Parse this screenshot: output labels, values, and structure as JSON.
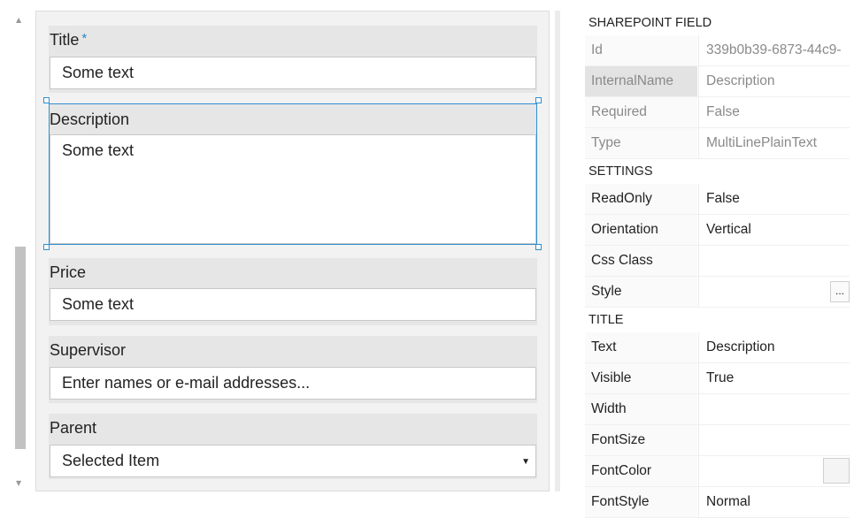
{
  "form": {
    "fields": [
      {
        "label": "Title",
        "required_marker": "*",
        "value": "Some text"
      },
      {
        "label": "Description",
        "value": "Some text"
      },
      {
        "label": "Price",
        "value": "Some text"
      },
      {
        "label": "Supervisor",
        "placeholder": "Enter names or e-mail addresses..."
      },
      {
        "label": "Parent",
        "value": "Selected Item"
      }
    ]
  },
  "properties": {
    "sections": [
      {
        "title": "SHAREPOINT FIELD",
        "rows": [
          {
            "key": "Id",
            "value": "339b0b39-6873-44c9-"
          },
          {
            "key": "InternalName",
            "value": "Description"
          },
          {
            "key": "Required",
            "value": "False"
          },
          {
            "key": "Type",
            "value": "MultiLinePlainText"
          }
        ]
      },
      {
        "title": "SETTINGS",
        "rows": [
          {
            "key": "ReadOnly",
            "value": "False"
          },
          {
            "key": "Orientation",
            "value": "Vertical"
          },
          {
            "key": "Css Class",
            "value": ""
          },
          {
            "key": "Style",
            "value": "",
            "button": "..."
          }
        ]
      },
      {
        "title": "TITLE",
        "rows": [
          {
            "key": "Text",
            "value": "Description"
          },
          {
            "key": "Visible",
            "value": "True"
          },
          {
            "key": "Width",
            "value": ""
          },
          {
            "key": "FontSize",
            "value": ""
          },
          {
            "key": "FontColor",
            "value": ""
          },
          {
            "key": "FontStyle",
            "value": "Normal"
          }
        ]
      }
    ]
  },
  "icons": {
    "scroll_up": "▲",
    "scroll_down": "▼",
    "dropdown": "▼"
  },
  "colors": {
    "accent": "#2e8fd2",
    "required": "#2b86c5"
  }
}
